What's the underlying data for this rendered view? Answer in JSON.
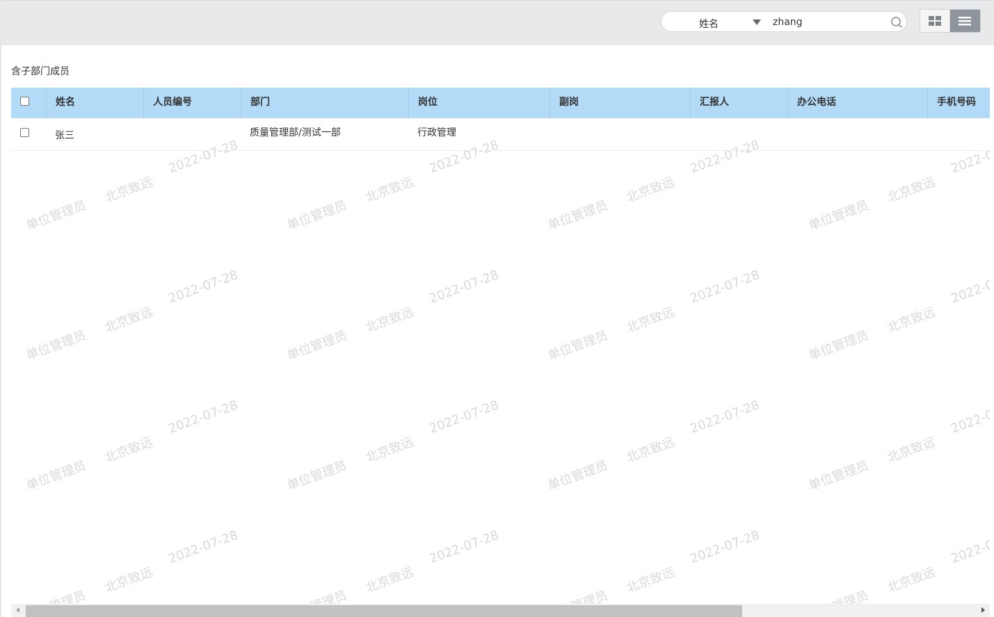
{
  "search": {
    "field": "姓名",
    "value": "zhang"
  },
  "section": {
    "label": "含子部门成员"
  },
  "table": {
    "headers": [
      "姓名",
      "人员编号",
      "部门",
      "岗位",
      "副岗",
      "汇报人",
      "办公电话",
      "手机号码"
    ],
    "rows": [
      {
        "name": "张三",
        "code": "",
        "dept": "质量管理部/测试一部",
        "post": "行政管理",
        "vice_post": "",
        "reporter": "",
        "office_phone": "",
        "mobile": ""
      }
    ]
  },
  "watermark": {
    "role": "单位管理员",
    "company": "北京致远",
    "date": "2022-07-28"
  },
  "icons": {
    "search": "search-icon",
    "caret": "caret-down-icon",
    "grid_view": "grid-view-icon",
    "list_view": "list-view-icon"
  },
  "colors": {
    "header_bg": "#b3daf7",
    "topbar_bg": "#e8e9eb",
    "active_view_bg": "#8e959c"
  }
}
